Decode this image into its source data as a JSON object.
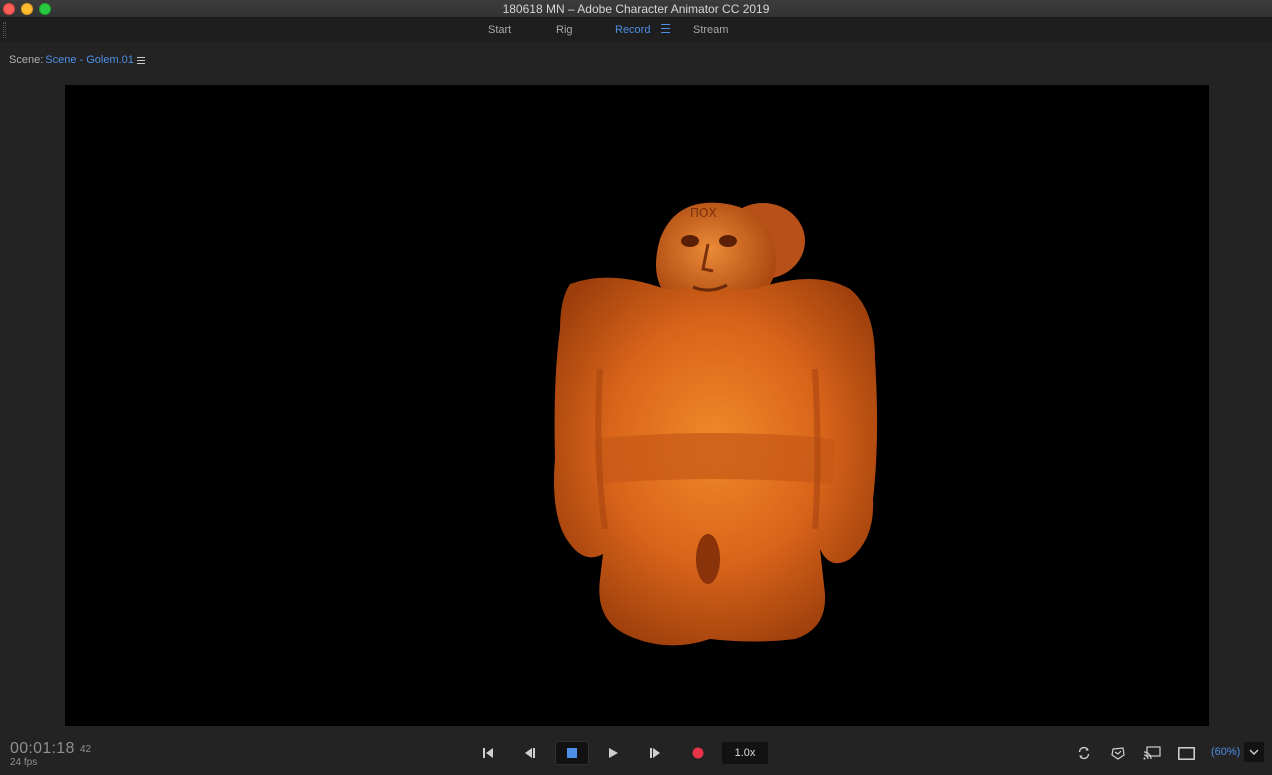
{
  "window": {
    "title": "180618 MN – Adobe Character Animator CC 2019"
  },
  "workspace_tabs": [
    {
      "label": "Start",
      "active": false
    },
    {
      "label": "Rig",
      "active": false
    },
    {
      "label": "Record",
      "active": true
    },
    {
      "label": "Stream",
      "active": false
    }
  ],
  "scene": {
    "label": "Scene:",
    "name": "Scene - Golem.01"
  },
  "playback": {
    "timecode": "00:01:18",
    "frame": "42",
    "fps": "24 fps",
    "speed": "1.0x",
    "zoom": "(60%)"
  },
  "icons": {
    "goto_start": "skip-to-start-icon",
    "step_back": "step-back-icon",
    "stop": "stop-icon",
    "play": "play-icon",
    "step_forward": "step-forward-icon",
    "record": "record-icon",
    "refresh": "refresh-icon",
    "puppet": "puppet-icon",
    "stream": "stream-icon",
    "screen": "screen-icon",
    "zoom_dropdown": "chevron-down-icon"
  },
  "colors": {
    "accent": "#4d8fe6",
    "record": "#e8344a",
    "stage": "#000000"
  }
}
